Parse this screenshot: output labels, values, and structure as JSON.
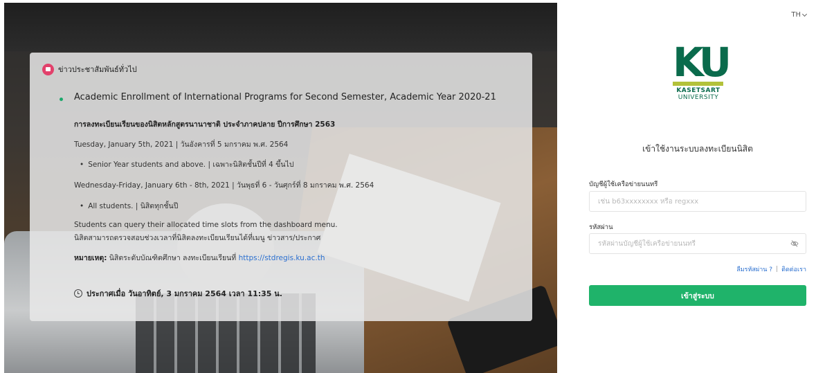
{
  "language": {
    "current": "TH"
  },
  "news": {
    "section_title": "ข่าวประชาสัมพันธ์ทั่วไป",
    "item": {
      "title": "Academic Enrollment of International Programs for Second Semester, Academic Year 2020-21",
      "subtitle": "การลงทะเบียนเรียนของนิสิตหลักสูตรนานาชาติ ประจำภาคปลาย ปีการศึกษา 2563",
      "line1": "Tuesday, January 5th, 2021 | วันอังคารที่ 5 มกราคม พ.ศ. 2564",
      "bullet1": "Senior Year students and above. | เฉพาะนิสิตชั้นปีที่ 4 ขึ้นไป",
      "line2": "Wednesday-Friday, January 6th - 8th, 2021 | วันพุธที่ 6 - วันศุกร์ที่ 8 มกราคม พ.ศ. 2564",
      "bullet2": "All students. | นิสิตทุกชั้นปี",
      "line3": "Students can query their allocated time slots from the dashboard menu.",
      "line4": "นิสิตสามารถตรวจสอบช่วงเวลาที่นิสิตลงทะเบียนเรียนได้ที่เมนู ข่าวสาร/ประกาศ",
      "note_label": "หมายเหตุ:",
      "note_text": " นิสิตระดับบัณฑิตศึกษา ลงทะเบียนเรียนที่ ",
      "note_link": "https://stdregis.ku.ac.th",
      "announced": "ประกาศเมื่อ วันอาทิตย์, 3 มกราคม 2564 เวลา 11:35 น."
    }
  },
  "logo": {
    "mark": "KU",
    "name": "KASETSART",
    "sub": "UNIVERSITY"
  },
  "login": {
    "title": "เข้าใช้งานระบบลงทะเบียนนิสิต",
    "username_label": "บัญชีผู้ใช้เครือข่ายนนทรี",
    "username_placeholder": "เช่น b63xxxxxxxx หรือ regxxx",
    "password_label": "รหัสผ่าน",
    "password_placeholder": "รหัสผ่านบัญชีผู้ใช้เครือข่ายนนทรี",
    "forgot_link": "ลืมรหัสผ่าน ?",
    "separator": "|",
    "contact_link": "ติดต่อเรา",
    "submit_label": "เข้าสู่ระบบ"
  }
}
